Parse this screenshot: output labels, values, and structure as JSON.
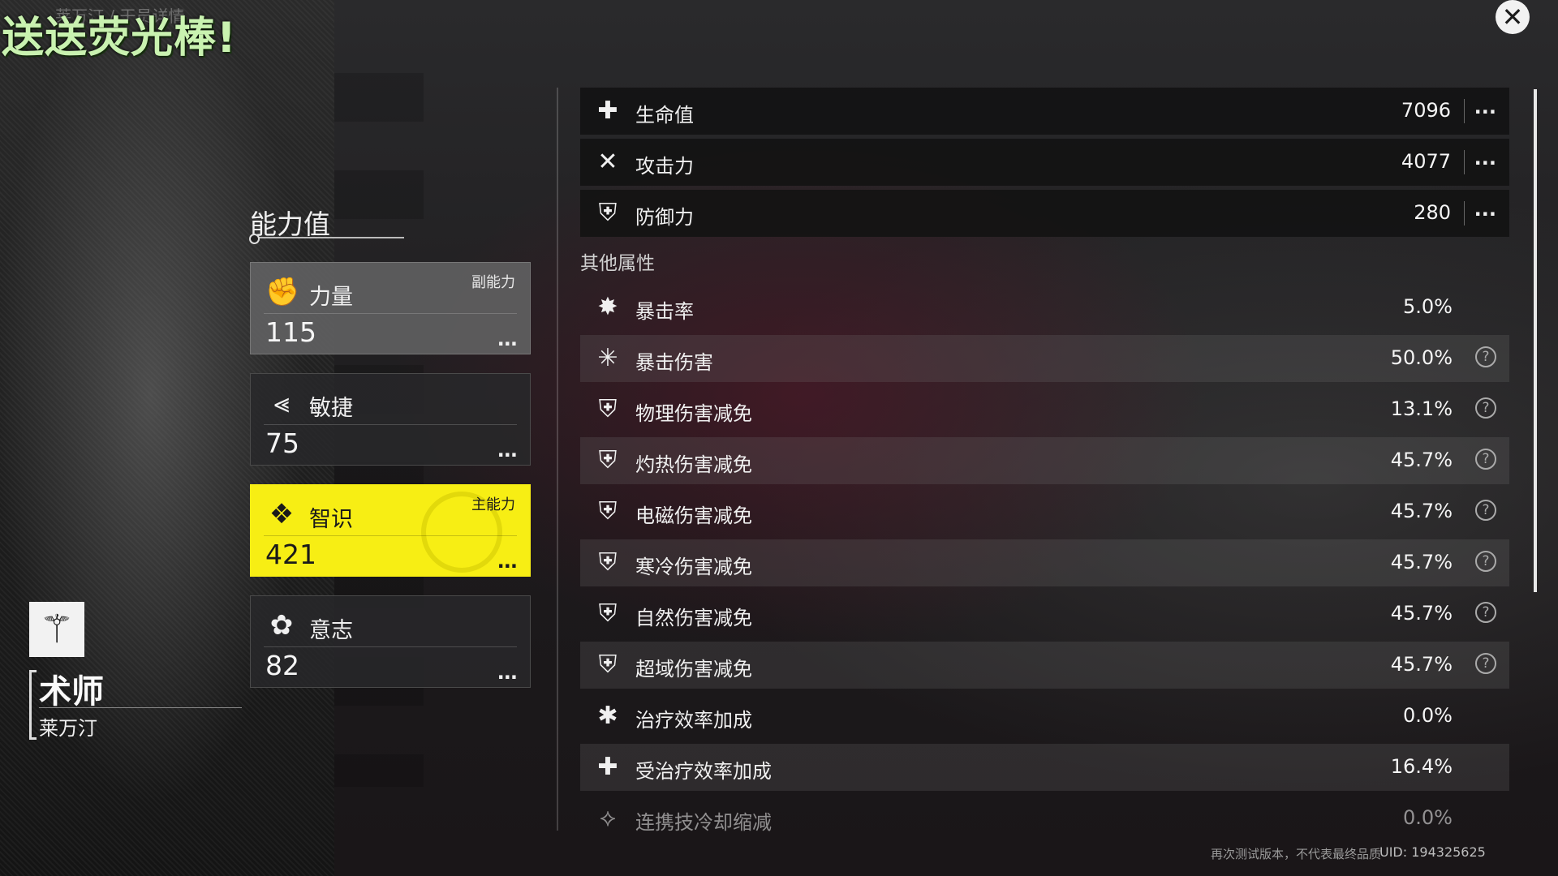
{
  "overlay": {
    "caption": "送送荧光棒!",
    "breadcrumb": "莱万汀 / 干员详情"
  },
  "icons": {
    "close": "close-icon",
    "strength": "fist-icon",
    "agility": "dash-icon",
    "intellect": "book-icon",
    "will": "will-icon",
    "class": "staff-icon"
  },
  "ability": {
    "title": "能力值",
    "cards": [
      {
        "name": "力量",
        "value": "115",
        "tag": "副能力",
        "more": "..."
      },
      {
        "name": "敏捷",
        "value": "75",
        "tag": "",
        "more": "..."
      },
      {
        "name": "智识",
        "value": "421",
        "tag": "主能力",
        "more": "..."
      },
      {
        "name": "意志",
        "value": "82",
        "tag": "",
        "more": "..."
      }
    ]
  },
  "character": {
    "class_name": "术师",
    "name": "莱万汀"
  },
  "main_stats": [
    {
      "icon": "plus-icon",
      "label": "生命值",
      "value": "7096",
      "more": "..."
    },
    {
      "icon": "swords-icon",
      "label": "攻击力",
      "value": "4077",
      "more": "..."
    },
    {
      "icon": "shield-icon",
      "label": "防御力",
      "value": "280",
      "more": "..."
    }
  ],
  "other": {
    "title": "其他属性",
    "stats": [
      {
        "icon": "burst-icon",
        "label": "暴击率",
        "value": "5.0%",
        "help": false
      },
      {
        "icon": "crit-damage-icon",
        "label": "暴击伤害",
        "value": "50.0%",
        "help": true
      },
      {
        "icon": "physical-shield-icon",
        "label": "物理伤害减免",
        "value": "13.1%",
        "help": true
      },
      {
        "icon": "heat-shield-icon",
        "label": "灼热伤害减免",
        "value": "45.7%",
        "help": true
      },
      {
        "icon": "electric-shield-icon",
        "label": "电磁伤害减免",
        "value": "45.7%",
        "help": true
      },
      {
        "icon": "cold-shield-icon",
        "label": "寒冷伤害减免",
        "value": "45.7%",
        "help": true
      },
      {
        "icon": "nature-shield-icon",
        "label": "自然伤害减免",
        "value": "45.7%",
        "help": true
      },
      {
        "icon": "ether-shield-icon",
        "label": "超域伤害减免",
        "value": "45.7%",
        "help": true
      },
      {
        "icon": "heal-icon",
        "label": "治疗效率加成",
        "value": "0.0%",
        "help": false
      },
      {
        "icon": "healed-icon",
        "label": "受治疗效率加成",
        "value": "16.4%",
        "help": false
      },
      {
        "icon": "chain-cooldown-icon",
        "label": "连携技冷却缩减",
        "value": "0.0%",
        "help": false
      }
    ],
    "help_symbol": "?"
  },
  "footer": {
    "notice": "再次测试版本，不代表最终品质",
    "uid": "UID: 194325625"
  }
}
